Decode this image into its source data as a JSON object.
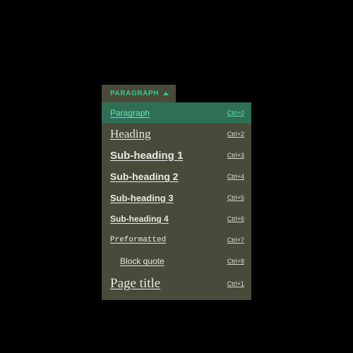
{
  "trigger": {
    "label": "Paragraph"
  },
  "items": [
    {
      "label": "Paragraph",
      "shortcut": "Ctrl+0",
      "styleClass": "sty-paragraph",
      "selected": true,
      "name": "style-paragraph"
    },
    {
      "label": "Heading",
      "shortcut": "Ctrl+2",
      "styleClass": "sty-heading",
      "selected": false,
      "name": "style-heading"
    },
    {
      "label": "Sub-heading 1",
      "shortcut": "Ctrl+3",
      "styleClass": "sty-sub1",
      "selected": false,
      "name": "style-subheading-1"
    },
    {
      "label": "Sub-heading 2",
      "shortcut": "Ctrl+4",
      "styleClass": "sty-sub2",
      "selected": false,
      "name": "style-subheading-2"
    },
    {
      "label": "Sub-heading 3",
      "shortcut": "Ctrl+5",
      "styleClass": "sty-sub3",
      "selected": false,
      "name": "style-subheading-3"
    },
    {
      "label": "Sub-heading 4",
      "shortcut": "Ctrl+6",
      "styleClass": "sty-sub4",
      "selected": false,
      "name": "style-subheading-4"
    },
    {
      "label": "Preformatted",
      "shortcut": "Ctrl+7",
      "styleClass": "sty-pre",
      "selected": false,
      "name": "style-preformatted"
    },
    {
      "label": "Block quote",
      "shortcut": "Ctrl+8",
      "styleClass": "sty-block",
      "selected": false,
      "name": "style-block-quote"
    },
    {
      "label": "Page title",
      "shortcut": "Ctrl+1",
      "styleClass": "sty-title",
      "selected": false,
      "name": "style-page-title"
    }
  ]
}
